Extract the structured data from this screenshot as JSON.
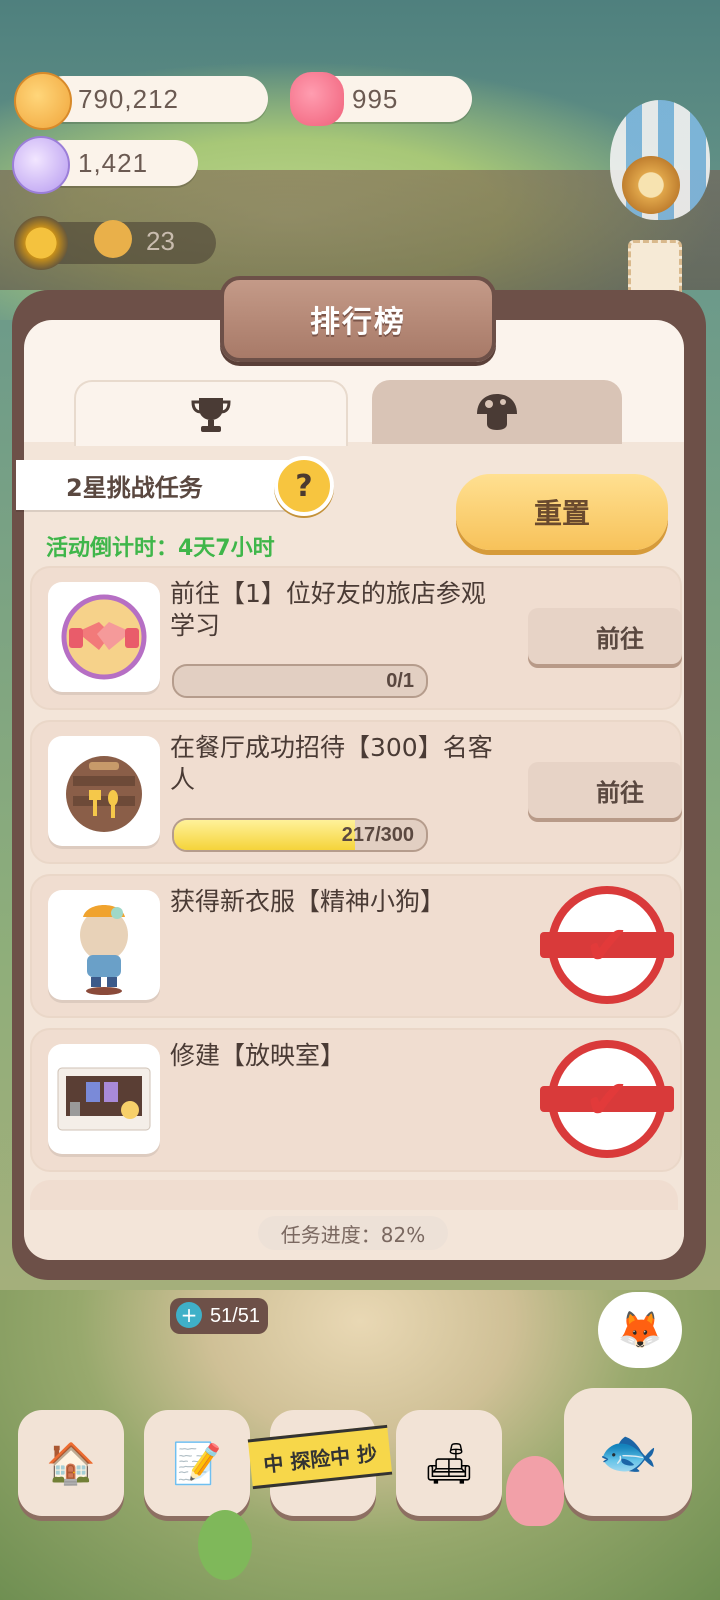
{
  "currencies": {
    "cookie_coins": "790,212",
    "jellies": "995",
    "crystals": "1,421",
    "cookie_count": "23"
  },
  "panel": {
    "title": "排行榜",
    "tabs": [
      {
        "icon": "trophy-icon",
        "active": true
      },
      {
        "icon": "mushroom-icon",
        "active": false
      }
    ],
    "challenge_label": "2星挑战任务",
    "help_symbol": "?",
    "reset_label": "重置",
    "countdown": "活动倒计时：4天7小时"
  },
  "tasks": [
    {
      "text": "前往【1】位好友的旅店参观学习",
      "progress": "0/1",
      "current": 0,
      "total": 1,
      "action": "前往",
      "done": false
    },
    {
      "text": "在餐厅成功招待【300】名客人",
      "progress": "217/300",
      "current": 217,
      "total": 300,
      "action": "前往",
      "done": false
    },
    {
      "text": "获得新衣服【精神小狗】",
      "progress": "",
      "current": 1,
      "total": 1,
      "action": "",
      "done": true
    },
    {
      "text": "修建【放映室】",
      "progress": "",
      "current": 1,
      "total": 1,
      "action": "",
      "done": true
    }
  ],
  "overall_progress": "任务进度：82%",
  "bottom": {
    "stamina": "51/51",
    "explore_tape": "中 探险中 抄"
  },
  "colors": {
    "accent_yellow": "#f7c25a",
    "countdown_green": "#3fb64a",
    "stamp_red": "#d93a3a",
    "panel_brown": "#6d5048"
  }
}
